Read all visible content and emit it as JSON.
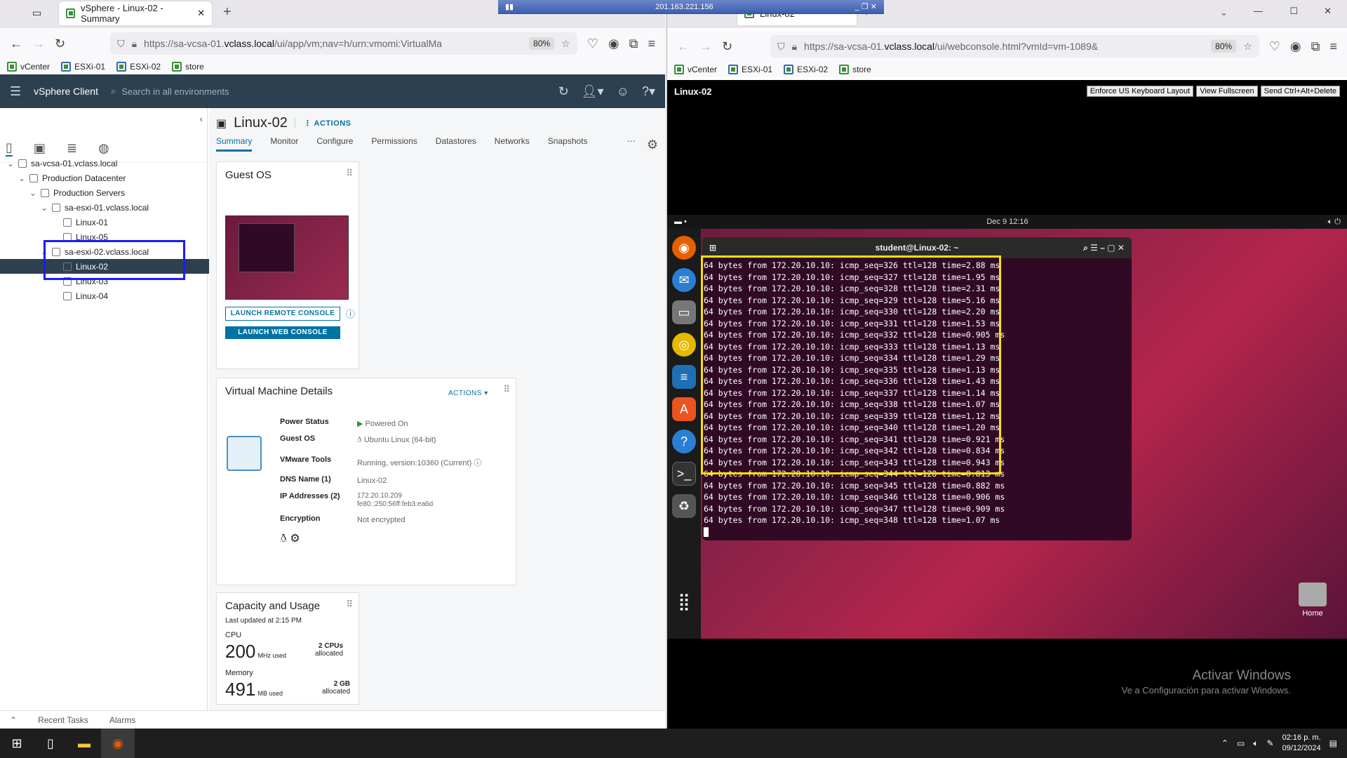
{
  "left_browser": {
    "tab_title": "vSphere - Linux-02 - Summary",
    "url_prefix": "https://sa-vcsa-01.",
    "url_domain": "vclass.local",
    "url_rest": "/ui/app/vm;nav=h/urn:vmomi:VirtualMa",
    "zoom": "80%",
    "bookmarks": [
      "vCenter",
      "ESXi-01",
      "ESXi-02",
      "store"
    ]
  },
  "rdp_bar": {
    "ip": "201.163.221.156"
  },
  "vsphere": {
    "brand": "vSphere Client",
    "search_placeholder": "Search in all environments",
    "tree": [
      {
        "label": "sa-vcsa-01.vclass.local",
        "indent": 0
      },
      {
        "label": "Production Datacenter",
        "indent": 1
      },
      {
        "label": "Production Servers",
        "indent": 2
      },
      {
        "label": "sa-esxi-01.vclass.local",
        "indent": 3
      },
      {
        "label": "Linux-01",
        "indent": 4
      },
      {
        "label": "Linux-05",
        "indent": 4
      },
      {
        "label": "sa-esxi-02.vclass.local",
        "indent": 3
      },
      {
        "label": "Linux-02",
        "indent": 4,
        "selected": true
      },
      {
        "label": "Linux-03",
        "indent": 4
      },
      {
        "label": "Linux-04",
        "indent": 4
      }
    ],
    "vm_name": "Linux-02",
    "actions_label": "ACTIONS",
    "tabs": [
      "Summary",
      "Monitor",
      "Configure",
      "Permissions",
      "Datastores",
      "Networks",
      "Snapshots"
    ],
    "guest_os": {
      "title": "Guest OS",
      "remote_btn": "LAUNCH REMOTE CONSOLE",
      "web_btn": "LAUNCH WEB CONSOLE"
    },
    "details": {
      "title": "Virtual Machine Details",
      "actions": "ACTIONS",
      "power_status_lbl": "Power Status",
      "power_status": "Powered On",
      "guest_os_lbl": "Guest OS",
      "guest_os": "Ubuntu Linux (64-bit)",
      "tools_lbl": "VMware Tools",
      "tools": "Running, version:10360 (Current)",
      "dns_lbl": "DNS Name (1)",
      "dns": "Linux-02",
      "ip_lbl": "IP Addresses (2)",
      "ip1": "172.20.10.209",
      "ip2": "fe80::250:56ff:feb3:ea6d",
      "enc_lbl": "Encryption",
      "enc": "Not encrypted"
    },
    "capacity": {
      "title": "Capacity and Usage",
      "updated": "Last updated at 2:15 PM",
      "cpu_lbl": "CPU",
      "cpu_val": "200",
      "cpu_unit": "MHz used",
      "cpu_alloc": "2 CPUs",
      "cpu_alloc2": "allocated",
      "mem_lbl": "Memory",
      "mem_val": "491",
      "mem_unit": "MB used",
      "mem_alloc": "2 GB",
      "mem_alloc2": "allocated"
    },
    "bottom": [
      "Recent Tasks",
      "Alarms"
    ]
  },
  "right_browser": {
    "tab_title": "Linux-02",
    "url_prefix": "https://sa-vcsa-01.",
    "url_domain": "vclass.local",
    "url_rest": "/ui/webconsole.html?vmId=vm-1089&",
    "zoom": "80%",
    "bookmarks": [
      "vCenter",
      "ESXi-01",
      "ESXi-02",
      "store"
    ],
    "console_title": "Linux-02",
    "console_buttons": [
      "Enforce US Keyboard Layout",
      "View Fullscreen",
      "Send Ctrl+Alt+Delete"
    ],
    "ubuntu_clock": "Dec 9  12:16",
    "terminal_title": "student@Linux-02: ~",
    "terminal_lines": [
      "64 bytes from 172.20.10.10: icmp_seq=326 ttl=128 time=2.88 ms",
      "64 bytes from 172.20.10.10: icmp_seq=327 ttl=128 time=1.95 ms",
      "64 bytes from 172.20.10.10: icmp_seq=328 ttl=128 time=2.31 ms",
      "64 bytes from 172.20.10.10: icmp_seq=329 ttl=128 time=5.16 ms",
      "64 bytes from 172.20.10.10: icmp_seq=330 ttl=128 time=2.20 ms",
      "64 bytes from 172.20.10.10: icmp_seq=331 ttl=128 time=1.53 ms",
      "64 bytes from 172.20.10.10: icmp_seq=332 ttl=128 time=0.905 ms",
      "64 bytes from 172.20.10.10: icmp_seq=333 ttl=128 time=1.13 ms",
      "64 bytes from 172.20.10.10: icmp_seq=334 ttl=128 time=1.29 ms",
      "64 bytes from 172.20.10.10: icmp_seq=335 ttl=128 time=1.13 ms",
      "64 bytes from 172.20.10.10: icmp_seq=336 ttl=128 time=1.43 ms",
      "64 bytes from 172.20.10.10: icmp_seq=337 ttl=128 time=1.14 ms",
      "64 bytes from 172.20.10.10: icmp_seq=338 ttl=128 time=1.07 ms",
      "64 bytes from 172.20.10.10: icmp_seq=339 ttl=128 time=1.12 ms",
      "64 bytes from 172.20.10.10: icmp_seq=340 ttl=128 time=1.20 ms",
      "64 bytes from 172.20.10.10: icmp_seq=341 ttl=128 time=0.921 ms",
      "64 bytes from 172.20.10.10: icmp_seq=342 ttl=128 time=0.834 ms",
      "64 bytes from 172.20.10.10: icmp_seq=343 ttl=128 time=0.943 ms",
      "64 bytes from 172.20.10.10: icmp_seq=344 ttl=128 time=0.813 ms",
      "64 bytes from 172.20.10.10: icmp_seq=345 ttl=128 time=0.882 ms",
      "64 bytes from 172.20.10.10: icmp_seq=346 ttl=128 time=0.906 ms",
      "64 bytes from 172.20.10.10: icmp_seq=347 ttl=128 time=0.909 ms",
      "64 bytes from 172.20.10.10: icmp_seq=348 ttl=128 time=1.07 ms"
    ],
    "home_label": "Home",
    "activate_title": "Activar Windows",
    "activate_sub": "Ve a Configuración para activar Windows."
  },
  "taskbar": {
    "time": "02:16 p. m.",
    "date": "09/12/2024"
  },
  "colors": {
    "vsphere_header": "#2d4050",
    "accent": "#0072a3",
    "selection_box": "#1a1aff",
    "highlight_box": "#ffe000"
  }
}
